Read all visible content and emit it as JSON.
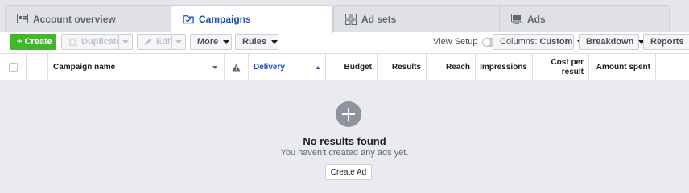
{
  "tabs": [
    {
      "label": "Account overview",
      "icon": "account-overview-icon",
      "active": false
    },
    {
      "label": "Campaigns",
      "icon": "campaigns-folder-icon",
      "active": true
    },
    {
      "label": "Ad sets",
      "icon": "ad-sets-grid-icon",
      "active": false
    },
    {
      "label": "Ads",
      "icon": "ads-monitor-icon",
      "active": false
    }
  ],
  "toolbar": {
    "create_label": "+ Create",
    "duplicate_label": "Duplicate",
    "edit_label": "Edit",
    "more_label": "More",
    "rules_label": "Rules",
    "view_setup_label": "View Setup",
    "columns_prefix": "Columns:",
    "columns_value": "Custom",
    "breakdown_label": "Breakdown",
    "reports_label": "Reports"
  },
  "table": {
    "columns": {
      "campaign_name": "Campaign name",
      "delivery": "Delivery",
      "budget": "Budget",
      "results": "Results",
      "reach": "Reach",
      "impressions": "Impressions",
      "cost_per_result_line1": "Cost per",
      "cost_per_result_line2": "result",
      "amount_spent": "Amount spent"
    },
    "sorted_column": "Delivery"
  },
  "empty_state": {
    "title": "No results found",
    "subtitle": "You haven't created any ads yet.",
    "button_label": "Create Ad"
  },
  "colors": {
    "accent_blue": "#1c4fb3",
    "create_green": "#42b72a",
    "background": "#e9ebee"
  }
}
